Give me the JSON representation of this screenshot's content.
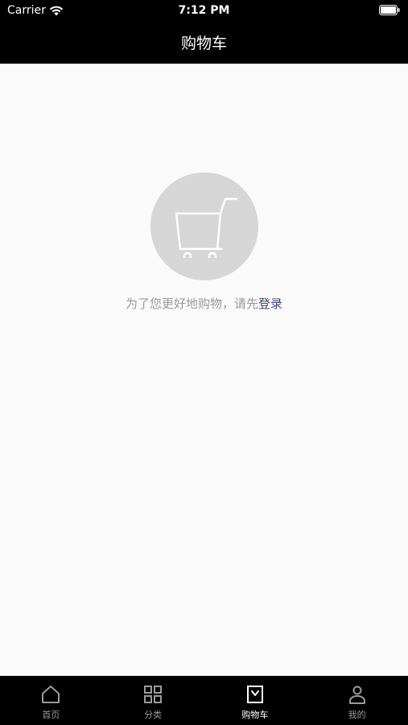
{
  "status_bar": {
    "carrier": "Carrier",
    "time": "7:12 PM"
  },
  "nav": {
    "title": "购物车"
  },
  "empty_state": {
    "message": "为了您更好地购物，请先",
    "login_label": "登录",
    "icon": "shopping-cart-icon"
  },
  "tabbar": {
    "items": [
      {
        "label": "首页",
        "icon": "home-icon"
      },
      {
        "label": "分类",
        "icon": "grid-icon"
      },
      {
        "label": "购物车",
        "icon": "cart-bag-icon",
        "active": true
      },
      {
        "label": "我的",
        "icon": "user-icon"
      }
    ]
  },
  "colors": {
    "bar_background": "#000000",
    "page_background": "#fafafa",
    "circle": "#d6d6d6",
    "link": "#3a4a7a",
    "muted_text": "#9a9a9a"
  }
}
